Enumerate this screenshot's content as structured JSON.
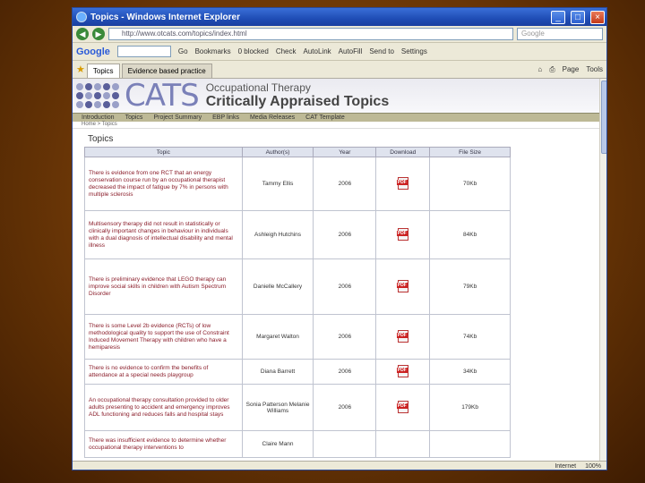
{
  "window": {
    "title": "Topics - Windows Internet Explorer"
  },
  "address": {
    "url": "http://www.otcats.com/topics/index.html",
    "search_placeholder": "Google"
  },
  "google_toolbar": {
    "logo": "Google",
    "items": [
      "Go",
      "Bookmarks",
      "0 blocked",
      "Check",
      "AutoLink",
      "AutoFill",
      "Send to",
      "Settings"
    ]
  },
  "tabs": [
    {
      "label": "Topics"
    },
    {
      "label": "Evidence based practice"
    }
  ],
  "tab_tools": [
    "Page",
    "Tools"
  ],
  "site": {
    "logo_word": "CATS",
    "subtitle": "Occupational Therapy",
    "title": "Critically Appraised Topics",
    "nav": [
      "Introduction",
      "Topics",
      "Project Summary",
      "EBP links",
      "Media Releases",
      "CAT Template"
    ],
    "breadcrumb": "Home > Topics",
    "page_title": "Topics"
  },
  "table": {
    "headers": [
      "Topic",
      "Author(s)",
      "Year",
      "Download",
      "File Size"
    ],
    "rows": [
      {
        "topic": "There is evidence from one RCT that an energy conservation course run by an occupational therapist decreased the impact of fatigue by 7% in persons with multiple sclerosis",
        "author": "Tammy Ellis",
        "year": "2006",
        "size": "70Kb"
      },
      {
        "topic": "Multisensory therapy did not result in statistically or clinically important changes in behaviour in individuals with a dual diagnosis of intellectual disability and mental illness",
        "author": "Ashleigh Hutchins",
        "year": "2006",
        "size": "84Kb"
      },
      {
        "topic": "There is preliminary evidence that LEGO therapy can improve social skills in children with Autism Spectrum Disorder",
        "author": "Danielle McCallery",
        "year": "2006",
        "size": "79Kb"
      },
      {
        "topic": "There is some Level 2b evidence (RCTs) of low methodological quality to support the use of Constraint Induced Movement Therapy with children who have a hemiparesis",
        "author": "Margaret Walton",
        "year": "2006",
        "size": "74Kb"
      },
      {
        "topic": "There is no evidence to confirm the benefits of attendance at a special needs playgroup",
        "author": "Diana Barrett",
        "year": "2006",
        "size": "34Kb"
      },
      {
        "topic": "An occupational therapy consultation provided to older adults presenting to accident and emergency improves ADL functioning and reduces falls and hospital stays",
        "author": "Sonia Patterson Melanie Williams",
        "year": "2006",
        "size": "179Kb"
      },
      {
        "topic": "There was insufficient evidence to determine whether occupational therapy interventions to",
        "author": "Claire Mann",
        "year": "",
        "size": ""
      }
    ]
  },
  "status": {
    "zone": "Internet",
    "zoom": "100%"
  }
}
